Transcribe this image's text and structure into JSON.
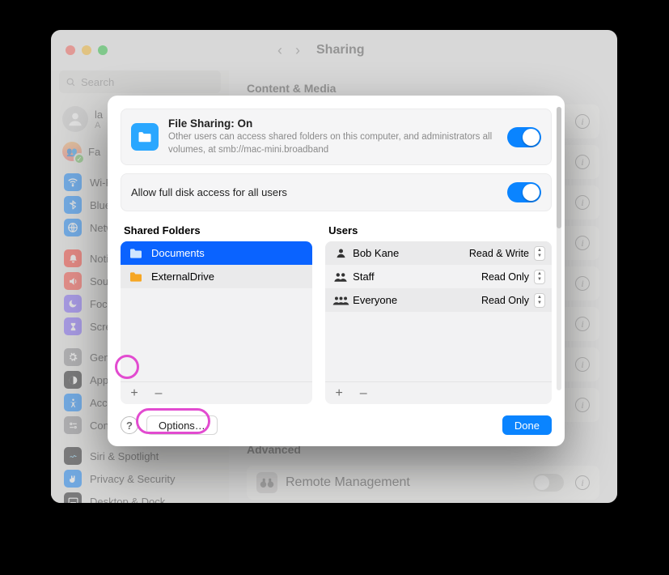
{
  "window": {
    "page_title": "Sharing",
    "search_placeholder": "Search",
    "user_name": "la",
    "user_sub": "A",
    "family_label": "Fa"
  },
  "sidebar": {
    "items": [
      {
        "label": "Wi-F",
        "icon": "wifi",
        "cls": "blue"
      },
      {
        "label": "Bluet",
        "icon": "bluetooth",
        "cls": "blue"
      },
      {
        "label": "Netw",
        "icon": "network",
        "cls": "blue"
      },
      {
        "label": "Notif",
        "icon": "bell",
        "cls": "red2"
      },
      {
        "label": "Soun",
        "icon": "sound",
        "cls": "red3"
      },
      {
        "label": "Focu",
        "icon": "moon",
        "cls": "purple"
      },
      {
        "label": "Scree",
        "icon": "hourglass",
        "cls": "purple"
      },
      {
        "label": "Gene",
        "icon": "gear",
        "cls": "gray"
      },
      {
        "label": "Appe",
        "icon": "appearance",
        "cls": "black"
      },
      {
        "label": "Acce",
        "icon": "accessibility",
        "cls": "blue"
      },
      {
        "label": "Cont",
        "icon": "control",
        "cls": "gray"
      },
      {
        "label": "Siri & Spotlight",
        "icon": "siri",
        "cls": "black"
      },
      {
        "label": "Privacy & Security",
        "icon": "hand",
        "cls": "blue"
      },
      {
        "label": "Desktop & Dock",
        "icon": "dock",
        "cls": "black"
      }
    ]
  },
  "content": {
    "section1_title": "Content & Media",
    "section2_title": "Advanced",
    "remote_label": "Remote Management"
  },
  "sheet": {
    "fs_title": "File Sharing: On",
    "fs_desc": "Other users can access shared folders on this computer, and administrators all volumes, at smb://mac-mini.broadband",
    "full_access_label": "Allow full disk access for all users",
    "folders_title": "Shared Folders",
    "users_title": "Users",
    "folders": [
      {
        "name": "Documents",
        "selected": true,
        "color": "#4da3ff"
      },
      {
        "name": "ExternalDrive",
        "selected": false,
        "color": "#f6a623"
      }
    ],
    "users": [
      {
        "name": "Bob Kane",
        "perm": "Read & Write",
        "icon": "person"
      },
      {
        "name": "Staff",
        "perm": "Read Only",
        "icon": "group2"
      },
      {
        "name": "Everyone",
        "perm": "Read Only",
        "icon": "group3"
      }
    ],
    "help": "?",
    "options_label": "Options…",
    "done_label": "Done",
    "plus": "+",
    "minus": "–"
  }
}
